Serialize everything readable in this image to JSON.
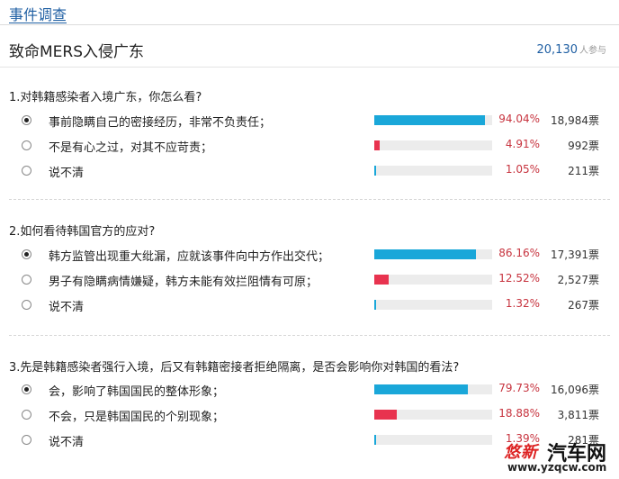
{
  "section_title": "事件调查",
  "survey_title": "致命MERS入侵广东",
  "participants": {
    "count": "20,130",
    "label": "人参与"
  },
  "colors": {
    "primary_bar": "#1aa7d9",
    "secondary_bar": "#e8334f",
    "percent_text": "#c7343f",
    "link": "#1f5fa3"
  },
  "questions": [
    {
      "text": "1.对韩籍感染者入境广东，你怎么看?",
      "options": [
        {
          "label": "事前隐瞒自己的密接经历，非常不负责任；",
          "percent": "94.04%",
          "value": 94.04,
          "votes": "18,984票",
          "selected": true
        },
        {
          "label": "不是有心之过，对其不应苛责；",
          "percent": "4.91%",
          "value": 4.91,
          "votes": "992票",
          "selected": false
        },
        {
          "label": "说不清",
          "percent": "1.05%",
          "value": 1.05,
          "votes": "211票",
          "selected": false
        }
      ]
    },
    {
      "text": "2.如何看待韩国官方的应对?",
      "options": [
        {
          "label": "韩方监管出现重大纰漏，应就该事件向中方作出交代；",
          "percent": "86.16%",
          "value": 86.16,
          "votes": "17,391票",
          "selected": true
        },
        {
          "label": "男子有隐瞒病情嫌疑，韩方未能有效拦阻情有可原；",
          "percent": "12.52%",
          "value": 12.52,
          "votes": "2,527票",
          "selected": false
        },
        {
          "label": "说不清",
          "percent": "1.32%",
          "value": 1.32,
          "votes": "267票",
          "selected": false
        }
      ]
    },
    {
      "text": "3.先是韩籍感染者强行入境，后又有韩籍密接者拒绝隔离，是否会影响你对韩国的看法?",
      "options": [
        {
          "label": "会，影响了韩国国民的整体形象；",
          "percent": "79.73%",
          "value": 79.73,
          "votes": "16,096票",
          "selected": true
        },
        {
          "label": "不会，只是韩国国民的个别现象；",
          "percent": "18.88%",
          "value": 18.88,
          "votes": "3,811票",
          "selected": false
        },
        {
          "label": "说不清",
          "percent": "1.39%",
          "value": 1.39,
          "votes": "281票",
          "selected": false
        }
      ]
    }
  ],
  "watermark": {
    "logo": "悠新",
    "name": "汽车网",
    "url": "www.yzqcw.com"
  }
}
